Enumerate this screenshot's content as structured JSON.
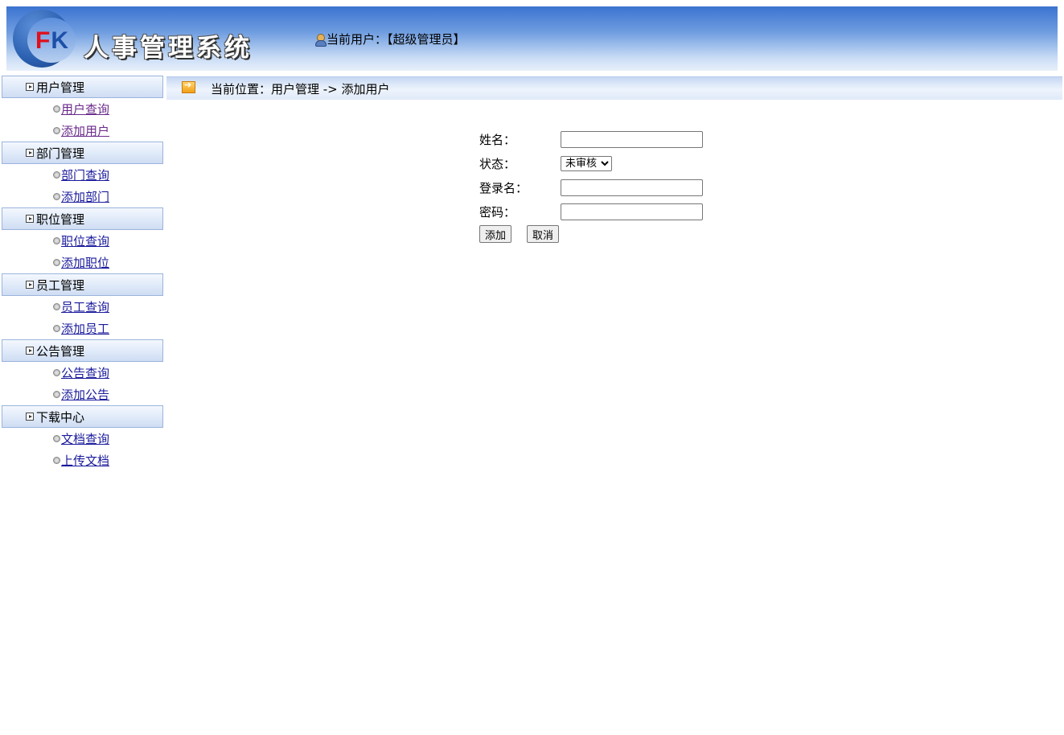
{
  "header": {
    "logo_letters_f": "F",
    "logo_letters_k": "K",
    "app_title": "人事管理系统",
    "current_user_label": "当前用户：【超级管理员】",
    "icons": {
      "user": "user-icon"
    }
  },
  "sidebar": {
    "groups": [
      {
        "label": "用户管理",
        "items": [
          {
            "label": "用户查询"
          },
          {
            "label": "添加用户"
          }
        ]
      },
      {
        "label": "部门管理",
        "items": [
          {
            "label": "部门查询"
          },
          {
            "label": "添加部门"
          }
        ]
      },
      {
        "label": "职位管理",
        "items": [
          {
            "label": "职位查询"
          },
          {
            "label": "添加职位"
          }
        ]
      },
      {
        "label": "员工管理",
        "items": [
          {
            "label": "员工查询"
          },
          {
            "label": "添加员工"
          }
        ]
      },
      {
        "label": "公告管理",
        "items": [
          {
            "label": "公告查询"
          },
          {
            "label": "添加公告"
          }
        ]
      },
      {
        "label": "下载中心",
        "items": [
          {
            "label": "文档查询"
          },
          {
            "label": "上传文档"
          }
        ]
      }
    ]
  },
  "breadcrumb": {
    "text": "当前位置：用户管理 -> 添加用户"
  },
  "form": {
    "name_label": "姓名：",
    "name_value": "",
    "status_label": "状态：",
    "status_selected": "未审核",
    "login_label": "登录名：",
    "login_value": "",
    "password_label": "密码：",
    "password_value": "",
    "add_button": "添加",
    "cancel_button": "取消"
  },
  "colors": {
    "header_top": "#3b73d0",
    "header_bottom": "#e8f0fb",
    "link": "#1a1a9c",
    "visited_link": "#6a2a8a",
    "logo_red": "#e0101c",
    "logo_blue": "#1d4fa8"
  }
}
